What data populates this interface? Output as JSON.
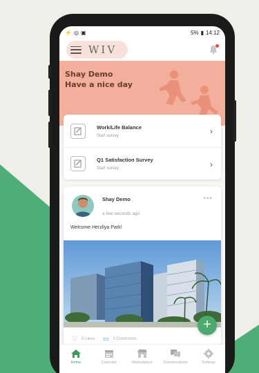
{
  "status": {
    "time": "14:12",
    "battery": "5%"
  },
  "app": {
    "logo": "WIV"
  },
  "hero": {
    "name": "Shay Demo",
    "greeting": "Have a nice day"
  },
  "surveys": [
    {
      "title": "Work/Life Balance",
      "subtitle": "Start survey"
    },
    {
      "title": "Q1 Satisfaction Survey",
      "subtitle": "Start survey"
    }
  ],
  "post": {
    "author": "Shay Demo",
    "time": "a few seconds ago",
    "text": "Welcome Herzliya Park!",
    "likes": "0 Likes",
    "comments": "0 Comments"
  },
  "tabs": [
    {
      "label": "Home",
      "icon": "home-icon",
      "active": true
    },
    {
      "label": "Calendar",
      "icon": "calendar-icon",
      "active": false
    },
    {
      "label": "Marketplace",
      "icon": "marketplace-icon",
      "active": false
    },
    {
      "label": "Conversations",
      "icon": "conversations-icon",
      "active": false
    },
    {
      "label": "Settings",
      "icon": "settings-icon",
      "active": false
    }
  ],
  "colors": {
    "accent": "#4caa6d",
    "hero": "#f2b09c",
    "background_green": "#4fae78"
  }
}
